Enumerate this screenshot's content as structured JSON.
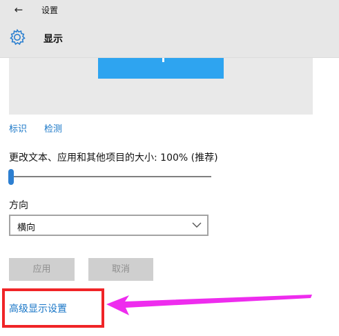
{
  "titlebar": {
    "back_icon": "arrow-left-icon",
    "app_title": "设置"
  },
  "header": {
    "icon": "gear-icon",
    "title": "显示"
  },
  "preview": {
    "monitor_color": "#2ea4f0"
  },
  "links": {
    "identify": "标识",
    "detect": "检测"
  },
  "scale": {
    "label": "更改文本、应用和其他项目的大小: 100% (推荐)",
    "value_percent": 100
  },
  "orientation": {
    "label": "方向",
    "selected": "横向"
  },
  "buttons": {
    "apply": "应用",
    "cancel": "取消"
  },
  "advanced_link": "高级显示设置",
  "annotation": {
    "highlight_color": "#f02427",
    "arrow_color": "#ee2cee"
  }
}
